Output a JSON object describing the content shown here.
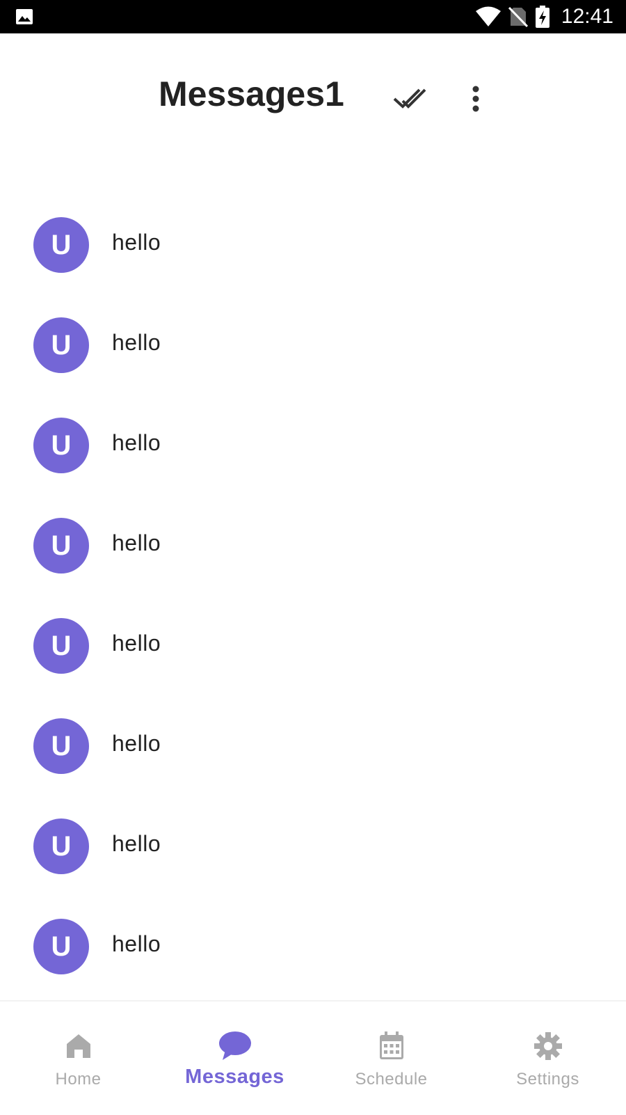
{
  "status_bar": {
    "time": "12:41",
    "left_icon": "image-icon",
    "icons": [
      "wifi-icon",
      "no-sim-icon",
      "battery-charging-icon"
    ]
  },
  "header": {
    "title": "Messages1",
    "actions": [
      {
        "icon": "double-check-icon"
      },
      {
        "icon": "more-vert-icon"
      }
    ]
  },
  "messages": [
    {
      "avatar_letter": "U",
      "text": "hello"
    },
    {
      "avatar_letter": "U",
      "text": "hello"
    },
    {
      "avatar_letter": "U",
      "text": "hello"
    },
    {
      "avatar_letter": "U",
      "text": "hello"
    },
    {
      "avatar_letter": "U",
      "text": "hello"
    },
    {
      "avatar_letter": "U",
      "text": "hello"
    },
    {
      "avatar_letter": "U",
      "text": "hello"
    },
    {
      "avatar_letter": "U",
      "text": "hello"
    }
  ],
  "bottom_nav": {
    "items": [
      {
        "label": "Home",
        "icon": "home-icon",
        "active": false
      },
      {
        "label": "Messages",
        "icon": "chat-bubble-icon",
        "active": true
      },
      {
        "label": "Schedule",
        "icon": "calendar-icon",
        "active": false
      },
      {
        "label": "Settings",
        "icon": "gear-icon",
        "active": false
      }
    ]
  },
  "colors": {
    "accent": "#7466d6",
    "inactive": "#aaaaaa",
    "text": "#222222"
  }
}
